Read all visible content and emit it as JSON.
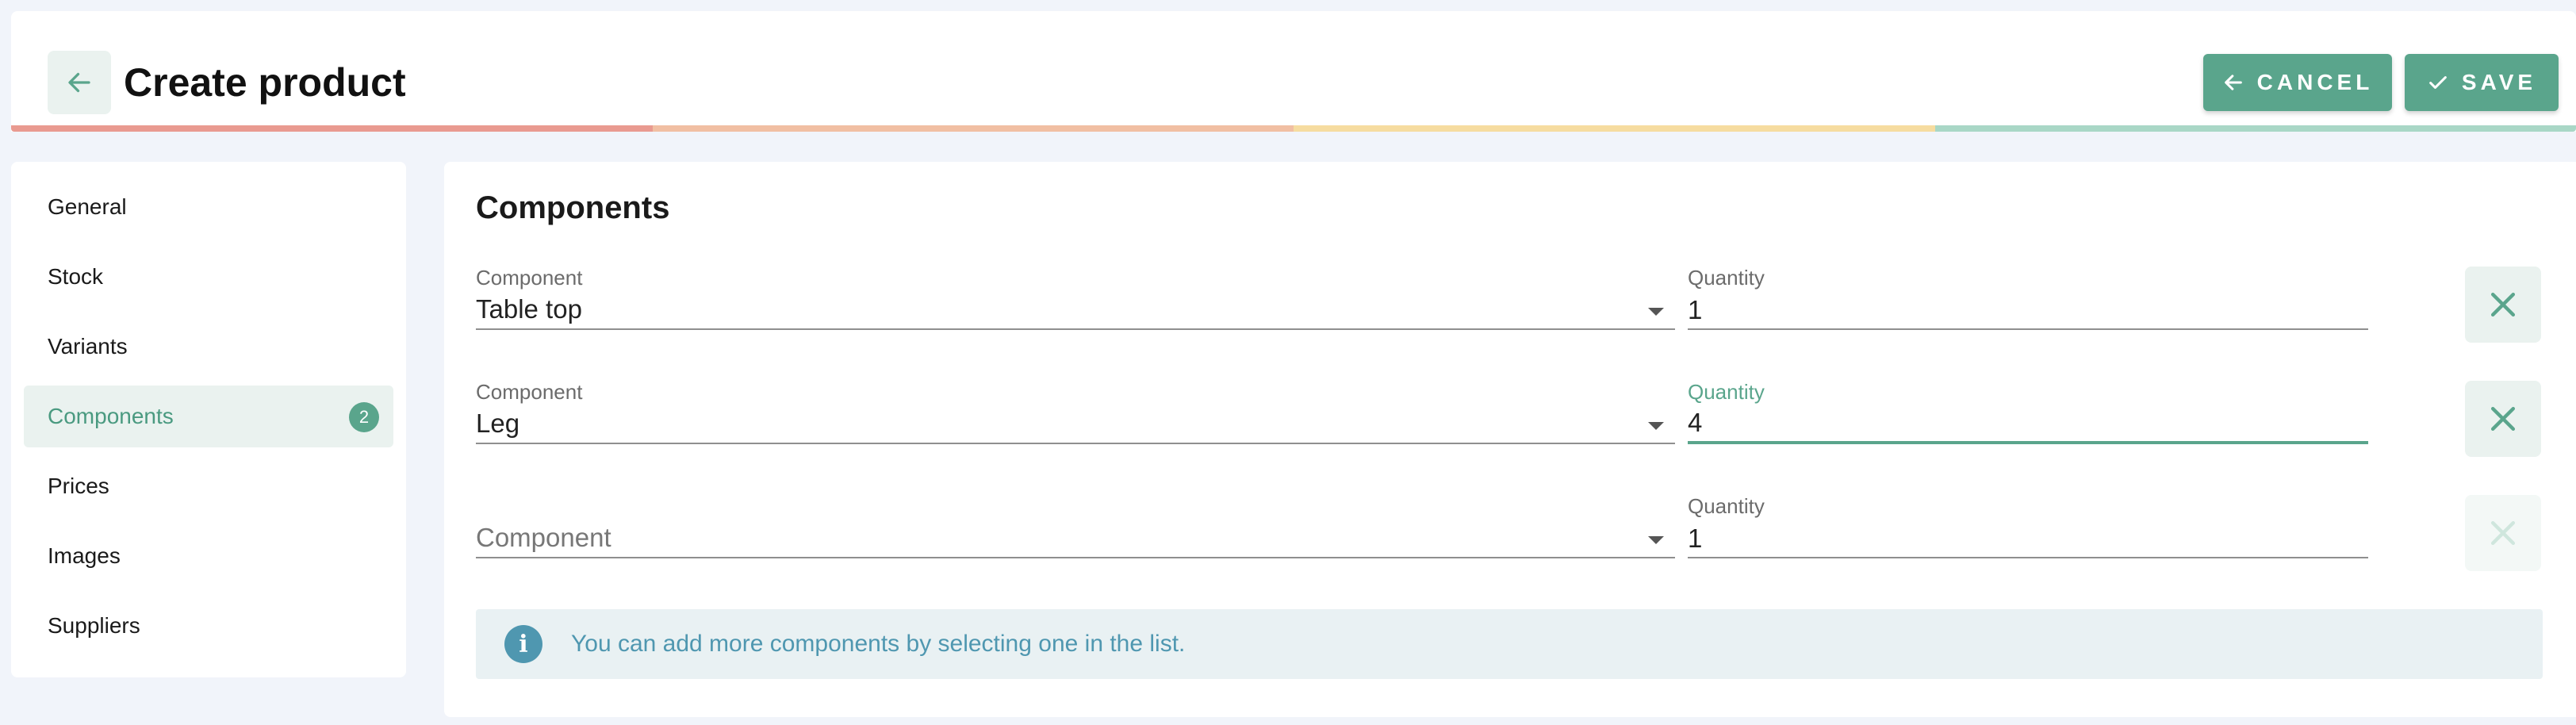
{
  "header": {
    "title": "Create product",
    "cancel_label": "CANCEL",
    "save_label": "SAVE",
    "progress_colors": [
      "#e99a90",
      "#f1bfa3",
      "#f6dca0",
      "#a9d7c6"
    ]
  },
  "sidebar": {
    "items": [
      {
        "label": "General",
        "active": false
      },
      {
        "label": "Stock",
        "active": false
      },
      {
        "label": "Variants",
        "active": false
      },
      {
        "label": "Components",
        "active": true,
        "badge": "2"
      },
      {
        "label": "Prices",
        "active": false
      },
      {
        "label": "Images",
        "active": false
      },
      {
        "label": "Suppliers",
        "active": false
      }
    ]
  },
  "main": {
    "section_title": "Components",
    "rows": [
      {
        "component_label": "Component",
        "component_value": "Table top",
        "quantity_label": "Quantity",
        "quantity_value": "1",
        "focused": false,
        "remove_enabled": true
      },
      {
        "component_label": "Component",
        "component_value": "Leg",
        "quantity_label": "Quantity",
        "quantity_value": "4",
        "focused": true,
        "remove_enabled": true
      },
      {
        "component_placeholder": "Component",
        "quantity_label": "Quantity",
        "quantity_value": "1",
        "focused": false,
        "remove_enabled": false
      }
    ],
    "info_text": "You can add more components by selecting one in the list."
  },
  "colors": {
    "accent": "#5aa58c",
    "info": "#4f97b0",
    "background": "#f1f4fa"
  },
  "icons": {
    "back": "arrow-left-icon",
    "cancel": "arrow-left-icon",
    "save": "check-icon",
    "remove": "close-icon",
    "info": "info-icon",
    "select": "caret-down-icon"
  }
}
